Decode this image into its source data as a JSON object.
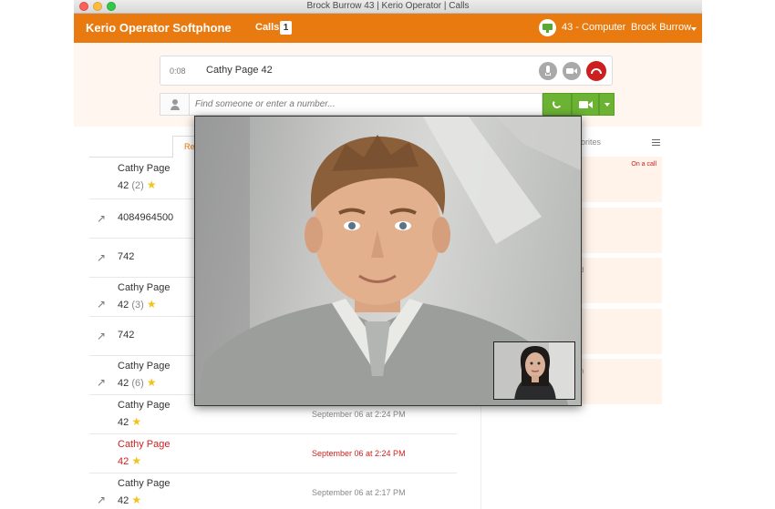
{
  "window": {
    "title": "Brock Burrow 43 | Kerio Operator | Calls"
  },
  "appbar": {
    "brand": "Kerio Operator Softphone",
    "calls_label": "Calls",
    "calls_count": "1",
    "device": "43 - Computer",
    "user": "Brock Burrow"
  },
  "active_call": {
    "timer": "0:08",
    "name": "Cathy Page 42"
  },
  "dial": {
    "placeholder": "Find someone or enter a number..."
  },
  "tabs": {
    "recent": "Recent",
    "favorites": "Favorites"
  },
  "recent": [
    {
      "name": "Cathy Page",
      "sub": "42",
      "count": "(2)",
      "star": true,
      "arrow": false,
      "time": "",
      "missed": false
    },
    {
      "name": "4084964500",
      "sub": "",
      "count": "",
      "star": false,
      "arrow": true,
      "time": "",
      "missed": false
    },
    {
      "name": "742",
      "sub": "",
      "count": "",
      "star": false,
      "arrow": true,
      "time": "",
      "missed": false
    },
    {
      "name": "Cathy Page",
      "sub": "42",
      "count": "(3)",
      "star": true,
      "arrow": true,
      "time": "",
      "missed": false
    },
    {
      "name": "742",
      "sub": "",
      "count": "",
      "star": false,
      "arrow": true,
      "time": "",
      "missed": false
    },
    {
      "name": "Cathy Page",
      "sub": "42",
      "count": "(6)",
      "star": true,
      "arrow": true,
      "time": "",
      "missed": false
    },
    {
      "name": "Cathy Page",
      "sub": "42",
      "count": "",
      "star": true,
      "arrow": false,
      "time": "September 06 at 2:24 PM",
      "missed": false
    },
    {
      "name": "Cathy Page",
      "sub": "42",
      "count": "",
      "star": true,
      "arrow": false,
      "time": "September 06 at 2:24 PM",
      "missed": true
    },
    {
      "name": "Cathy Page",
      "sub": "42",
      "count": "",
      "star": true,
      "arrow": true,
      "time": "September 06 at 2:17 PM",
      "missed": false
    }
  ],
  "favorites": [
    {
      "status": "On a call",
      "frag": ""
    },
    {
      "status": "",
      "frag": ""
    },
    {
      "status": "",
      "frag": "d"
    },
    {
      "status": "",
      "frag": ""
    },
    {
      "status": "",
      "frag": "n"
    }
  ],
  "glyphs": {
    "arrow": "↗",
    "star": "★"
  },
  "colors": {
    "accent": "#e97a10",
    "call_green": "#6cb333",
    "hangup_red": "#cc1f1f",
    "missed_red": "#cc1f1f",
    "star_yellow": "#f2c31a"
  }
}
